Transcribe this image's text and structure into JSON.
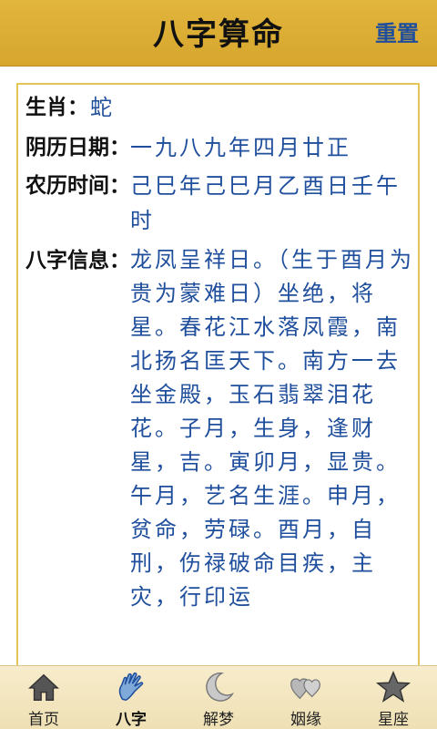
{
  "header": {
    "title": "八字算命",
    "reset_label": "重置"
  },
  "info": {
    "zodiac_label": "生肖：",
    "zodiac_value": "蛇",
    "lunar_date_label": "阴历日期：",
    "lunar_date_value": "一九八九年四月廿正",
    "lunar_time_label": "农历时间：",
    "lunar_time_value": "己巳年己巳月乙酉日壬午时",
    "bazi_label": "八字信息：",
    "bazi_value": "龙凤呈祥日。（生于酉月为贵为蒙难日）坐绝，将星。春花江水落凤霞，南北扬名匡天下。南方一去坐金殿，玉石翡翠泪花花。子月，生身，逢财星，吉。寅卯月，显贵。午月，艺名生涯。申月，贫命，劳碌。酉月，自刑，伤禄破命目疾，主灾，行印运"
  },
  "tabbar": {
    "tabs": [
      {
        "label": "首页",
        "icon": "home-icon"
      },
      {
        "label": "八字",
        "icon": "hand-icon"
      },
      {
        "label": "解梦",
        "icon": "moon-icon"
      },
      {
        "label": "姻缘",
        "icon": "hearts-icon"
      },
      {
        "label": "星座",
        "icon": "star-icon"
      }
    ],
    "active_index": 1
  },
  "colors": {
    "header_bg": "#d9a931",
    "value_text": "#1f4f9c",
    "content_border": "#e5c558",
    "tabbar_bg": "#f3e6c0"
  }
}
